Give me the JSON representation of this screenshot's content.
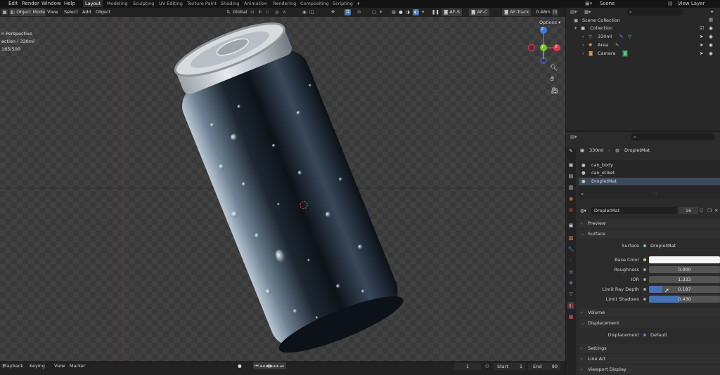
{
  "menu": {
    "items": [
      "Edit",
      "Render",
      "Window",
      "Help"
    ],
    "workspaces": [
      "Layout",
      "Modeling",
      "Sculpting",
      "UV Editing",
      "Texture Paint",
      "Shading",
      "Animation",
      "Rendering",
      "Compositing",
      "Scripting"
    ],
    "active_workspace": "Layout",
    "add_tab": "+",
    "scene": "Scene",
    "view_layer": "View Layer"
  },
  "viewport_header": {
    "mode": "Object Mode",
    "menus": [
      "View",
      "Select",
      "Add",
      "Object"
    ],
    "orientation": "Global",
    "af_s": "AF-S",
    "af_c": "AF-C",
    "af_track": "AF-Track",
    "distance": "0.48m",
    "options": "Options"
  },
  "viewport": {
    "overlay_lines": [
      "n Perspective",
      "ection | 330ml",
      " 165/500"
    ],
    "gizmo_axes": {
      "x": "X",
      "y": "Y",
      "z": "Z"
    },
    "colors": {
      "x": "#e5394b",
      "y": "#7ec12c",
      "z": "#3d7ce0",
      "grid_line": "#8a3a3a"
    }
  },
  "timeline": {
    "menus": [
      "Playback",
      "Keying",
      "View",
      "Marker"
    ],
    "current_frame": "1",
    "start_label": "Start",
    "start": "1",
    "end_label": "End",
    "end": "90"
  },
  "outliner": {
    "search_placeholder": "",
    "root": "Scene Collection",
    "collection": "Collection",
    "items": [
      "330ml",
      "Area",
      "Camera"
    ]
  },
  "properties": {
    "breadcrumb_object": "330ml",
    "breadcrumb_material": "DropletMat",
    "slots": [
      "can_body",
      "can_etiket",
      "DropletMat"
    ],
    "slot_handle": "::::",
    "material_name": "DropletMat",
    "user_count": "16",
    "sections": {
      "preview": "Preview",
      "surface": "Surface",
      "volume": "Volume",
      "displacement": "Displacement",
      "settings": "Settings",
      "line_art": "Line Art",
      "viewport_display": "Viewport Display"
    },
    "surface": {
      "surface_label": "Surface",
      "surface_value": "DropletMat",
      "base_color_label": "Base Color",
      "roughness_label": "Roughness",
      "roughness_value": "0.000",
      "ior_label": "IOR",
      "ior_value": "1.333",
      "ray_depth_label": "Limit Ray Depth",
      "ray_depth_value": "0.187",
      "shadows_label": "Limit Shadows",
      "shadows_value": "0.430"
    },
    "displacement": {
      "label": "Displacement",
      "value": "Default"
    },
    "accent_color": "#4772b3"
  }
}
